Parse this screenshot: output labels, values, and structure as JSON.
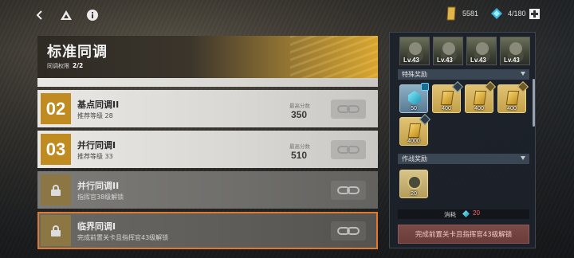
{
  "topbar": {
    "back_icon": "chevron-left-icon",
    "home_icon": "triangle-logo-icon",
    "info_icon": "info-icon",
    "gold_amount": "5581",
    "energy_amount": "4/180",
    "add_icon": "plus-icon"
  },
  "header": {
    "title": "标准同调",
    "subtitle_label": "同调权限",
    "subtitle_value": "2/2"
  },
  "stages": [
    {
      "num": "02",
      "name": "基点同调II",
      "desc": "推荐等级 28",
      "score_label": "最高分数",
      "score": "350",
      "locked": false
    },
    {
      "num": "03",
      "name": "并行同调I",
      "desc": "推荐等级 33",
      "score_label": "最高分数",
      "score": "510",
      "locked": false
    },
    {
      "num": "",
      "name": "并行同调II",
      "desc": "指挥官38级解锁",
      "score_label": "",
      "score": "",
      "locked": true
    },
    {
      "num": "",
      "name": "临界同调I",
      "desc": "完成前置关卡且指挥官43级解锁",
      "score_label": "",
      "score": "",
      "locked": true
    }
  ],
  "panel": {
    "enemies": [
      {
        "level": "Lv.43"
      },
      {
        "level": "Lv.43"
      },
      {
        "level": "Lv.43"
      },
      {
        "level": "Lv.43"
      }
    ],
    "special_rewards_label": "特殊奖励",
    "special_rewards": [
      {
        "count": "50",
        "kind": "crystal"
      },
      {
        "count": "400",
        "kind": "gold"
      },
      {
        "count": "400",
        "kind": "gold"
      },
      {
        "count": "400",
        "kind": "gold"
      },
      {
        "count": "4000",
        "kind": "gold"
      }
    ],
    "battle_rewards_label": "作战奖励",
    "battle_rewards": [
      {
        "count": "20",
        "kind": "medal"
      }
    ],
    "consume_label": "消耗",
    "consume_value": "20",
    "start_button": "完成前置关卡且指挥官43级解锁"
  },
  "colors": {
    "accent_gold": "#c08b20",
    "selected_outline": "#e07a2a",
    "consume_red": "#ff6b6b"
  }
}
